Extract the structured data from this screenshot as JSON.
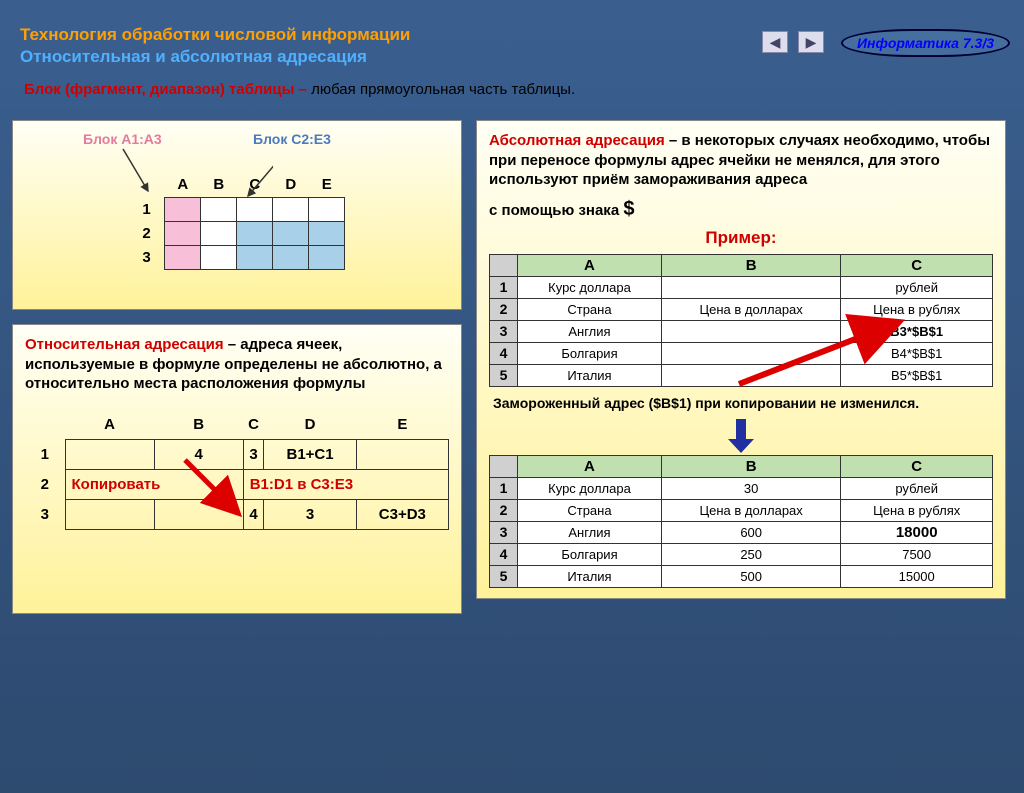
{
  "badge": "Информатика  7.3/3",
  "heading1": "Технология обработки числовой информации",
  "heading2": "Относительная и абсолютная адресация",
  "definition_prefix": "Блок (фрагмент, диапазон) таблицы – ",
  "definition_body": "любая прямоугольная часть таблицы.",
  "block_labels": {
    "left": "Блок A1:A3",
    "right": "Блок C2:E3"
  },
  "mini_cols": [
    "A",
    "B",
    "C",
    "D",
    "E"
  ],
  "mini_rows": [
    "1",
    "2",
    "3"
  ],
  "relative_para_red": "Относительная адресация",
  "relative_para_body": " – адреса ячеек, используемые в формуле определены не абсолютно, а относительно места расположения формулы",
  "rel_cols": [
    "A",
    "B",
    "C",
    "D",
    "E"
  ],
  "rel_rows": [
    "1",
    "2",
    "3"
  ],
  "rel_data": {
    "r1": [
      "",
      "4",
      "3",
      "B1+C1",
      ""
    ],
    "r2_copy_left": "Копировать",
    "r2_copy_right": "B1:D1 в C3:E3",
    "r3": [
      "",
      "",
      "4",
      "3",
      "C3+D3"
    ]
  },
  "absolute_para_red": "Абсолютная адресация",
  "absolute_para_body": " – в некоторых случаях необходимо, чтобы при переносе формулы адрес ячейки не менялся, для этого используют приём замораживания адреса",
  "absolute_para_tail": "с помощью знака ",
  "absolute_sign": "$",
  "example_label": "Пример:",
  "ex_cols": [
    "A",
    "B",
    "C"
  ],
  "ex_rowh": [
    "1",
    "2",
    "3",
    "4",
    "5"
  ],
  "ex1": [
    [
      "Курс доллара",
      "",
      "рублей"
    ],
    [
      "Страна",
      "Цена в долларах",
      "Цена в рублях"
    ],
    [
      "Англия",
      "",
      "B3*$B$1"
    ],
    [
      "Болгария",
      "",
      "B4*$B$1"
    ],
    [
      "Италия",
      "",
      "B5*$B$1"
    ]
  ],
  "frozen_note": "Замороженный адрес ($B$1) при копировании не изменился.",
  "ex2": [
    [
      "Курс доллара",
      "30",
      "рублей"
    ],
    [
      "Страна",
      "Цена в долларах",
      "Цена в рублях"
    ],
    [
      "Англия",
      "600",
      "18000"
    ],
    [
      "Болгария",
      "250",
      "7500"
    ],
    [
      "Италия",
      "500",
      "15000"
    ]
  ]
}
